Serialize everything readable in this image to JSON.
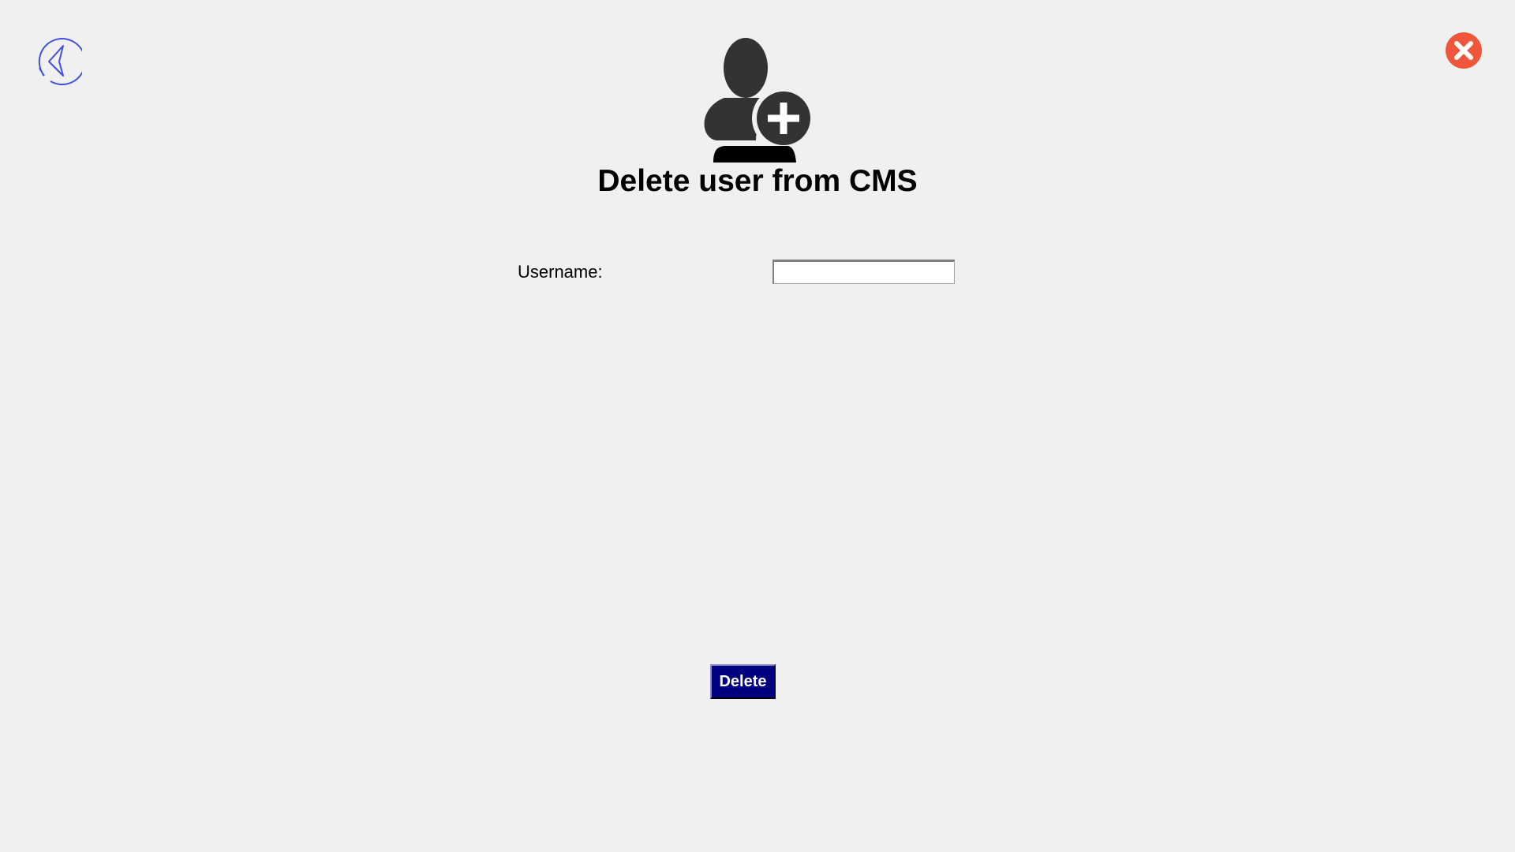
{
  "header": {
    "title": "Delete user from CMS",
    "back_icon": "back-arrow-circle-icon",
    "close_icon": "close-circle-icon",
    "user_icon": "add-user-icon"
  },
  "form": {
    "username_label": "Username:",
    "username_value": "",
    "delete_label": "Delete"
  },
  "colors": {
    "back": "#3f51e0",
    "close": "#f0563a",
    "button": "#000080",
    "icon": "#333333"
  }
}
